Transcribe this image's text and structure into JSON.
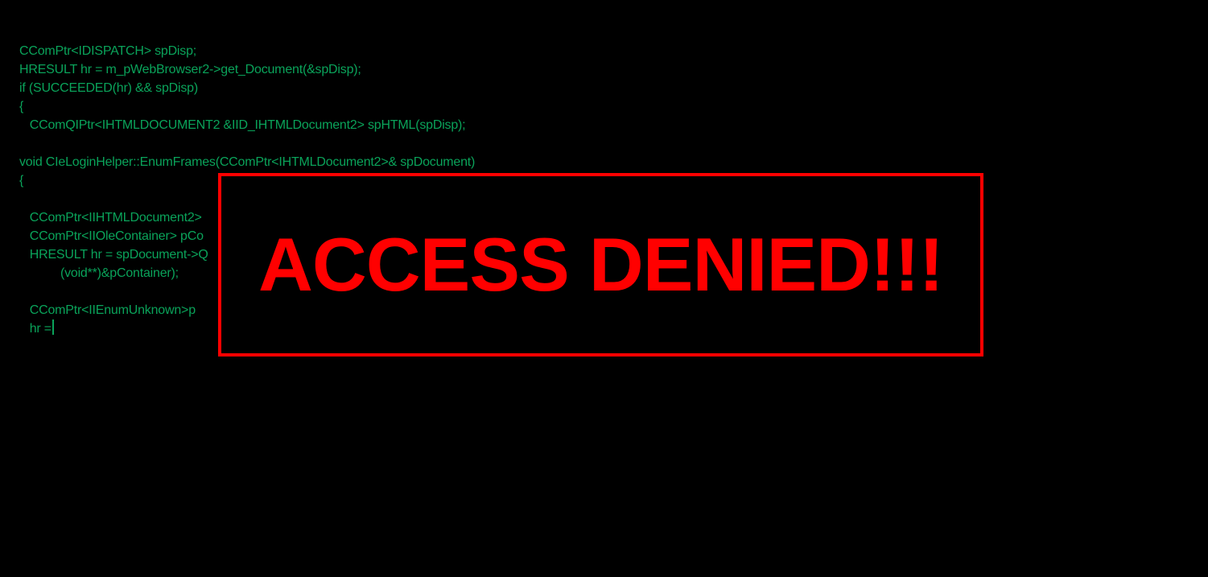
{
  "colors": {
    "background": "#000000",
    "code_text": "#0aa35a",
    "alert": "#ff0000"
  },
  "code": {
    "lines": [
      "CComPtr<IDISPATCH> spDisp;",
      "HRESULT hr = m_pWebBrowser2->get_Document(&spDisp);",
      "if (SUCCEEDED(hr) && spDisp)",
      "{",
      "   CComQIPtr<IHTMLDOCUMENT2 &IID_IHTMLDocument2> spHTML(spDisp);",
      "",
      "void CIeLoginHelper::EnumFrames(CComPtr<IHTMLDocument2>& spDocument)",
      "{",
      "",
      "   CComPtr<IIHTMLDocument2>",
      "   CComPtr<IIOleContainer> pCo",
      "   HRESULT hr = spDocument->Q",
      "            (void**)&pContainer);",
      "",
      "   CComPtr<IIEnumUnknown>p",
      "   hr ="
    ]
  },
  "alert": {
    "message": "ACCESS DENIED!!!"
  }
}
